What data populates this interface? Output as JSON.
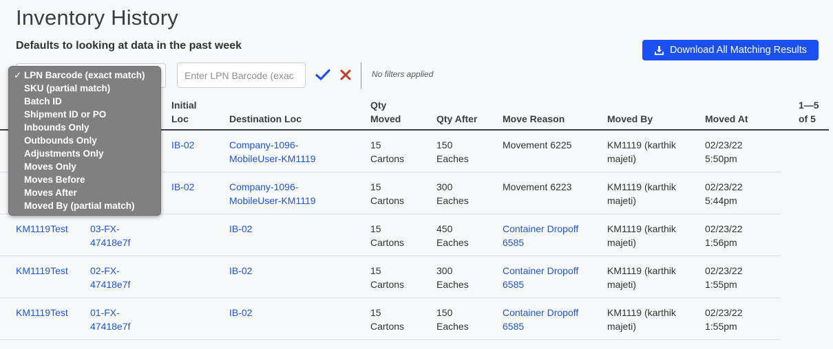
{
  "page": {
    "title": "Inventory History",
    "subtitle": "Defaults to looking at data in the past week"
  },
  "toolbar": {
    "download_label": "Download All Matching Results",
    "lpn_placeholder": "Enter LPN Barcode (exac",
    "filter_status": "No filters applied"
  },
  "dropdown": {
    "selected": "LPN Barcode (exact match)",
    "check_glyph": "✓",
    "options": [
      "LPN Barcode (exact match)",
      "SKU (partial match)",
      "Batch ID",
      "Shipment ID or PO",
      "Inbounds Only",
      "Outbounds Only",
      "Adjustments Only",
      "Moves Only",
      "Moves Before",
      "Moves After",
      "Moved By (partial match)"
    ]
  },
  "table": {
    "headers": {
      "initial_loc_1": "Initial",
      "initial_loc_2": "Loc",
      "destination_loc": "Destination Loc",
      "qty_moved_1": "Qty",
      "qty_moved_2": "Moved",
      "qty_after": "Qty After",
      "move_reason": "Move Reason",
      "moved_by": "Moved By",
      "moved_at": "Moved At",
      "pagination_1": "1—5",
      "pagination_2": "of 5"
    },
    "rows": [
      {
        "lpn": "",
        "sku_1": "",
        "sku_2": "",
        "initial_loc": "IB-02",
        "dest_1": "Company-1096-",
        "dest_2": "MobileUser-KM1119",
        "qty_moved_1": "15",
        "qty_moved_2": "Cartons",
        "qty_after_1": "150",
        "qty_after_2": "Eaches",
        "reason_1": "Movement 6225",
        "reason_2": "",
        "moved_by_1": "KM1119 (karthik",
        "moved_by_2": "majeti)",
        "moved_at_1": "02/23/22",
        "moved_at_2": "5:50pm"
      },
      {
        "lpn": "",
        "sku_1": "",
        "sku_2": "",
        "initial_loc": "IB-02",
        "dest_1": "Company-1096-",
        "dest_2": "MobileUser-KM1119",
        "qty_moved_1": "15",
        "qty_moved_2": "Cartons",
        "qty_after_1": "300",
        "qty_after_2": "Eaches",
        "reason_1": "Movement 6223",
        "reason_2": "",
        "moved_by_1": "KM1119 (karthik",
        "moved_by_2": "majeti)",
        "moved_at_1": "02/23/22",
        "moved_at_2": "5:44pm"
      },
      {
        "lpn": "KM1119Test",
        "sku_1": "03-FX-",
        "sku_2": "47418e7f",
        "initial_loc": "",
        "dest_1": "IB-02",
        "dest_2": "",
        "qty_moved_1": "15",
        "qty_moved_2": "Cartons",
        "qty_after_1": "450",
        "qty_after_2": "Eaches",
        "reason_1": "Container Dropoff",
        "reason_2": "6585",
        "moved_by_1": "KM1119 (karthik",
        "moved_by_2": "majeti)",
        "moved_at_1": "02/23/22",
        "moved_at_2": "1:56pm"
      },
      {
        "lpn": "KM1119Test",
        "sku_1": "02-FX-",
        "sku_2": "47418e7f",
        "initial_loc": "",
        "dest_1": "IB-02",
        "dest_2": "",
        "qty_moved_1": "15",
        "qty_moved_2": "Cartons",
        "qty_after_1": "300",
        "qty_after_2": "Eaches",
        "reason_1": "Container Dropoff",
        "reason_2": "6585",
        "moved_by_1": "KM1119 (karthik",
        "moved_by_2": "majeti)",
        "moved_at_1": "02/23/22",
        "moved_at_2": "1:55pm"
      },
      {
        "lpn": "KM1119Test",
        "sku_1": "01-FX-",
        "sku_2": "47418e7f",
        "initial_loc": "",
        "dest_1": "IB-02",
        "dest_2": "",
        "qty_moved_1": "15",
        "qty_moved_2": "Cartons",
        "qty_after_1": "150",
        "qty_after_2": "Eaches",
        "reason_1": "Container Dropoff",
        "reason_2": "6585",
        "moved_by_1": "KM1119 (karthik",
        "moved_by_2": "majeti)",
        "moved_at_1": "02/23/22",
        "moved_at_2": "1:55pm"
      }
    ]
  },
  "colors": {
    "accent": "#1a4ff0",
    "link": "#1f55d6",
    "confirm": "#1a4ff0",
    "clear": "#c0392b",
    "dropdown_bg": "#808080"
  }
}
